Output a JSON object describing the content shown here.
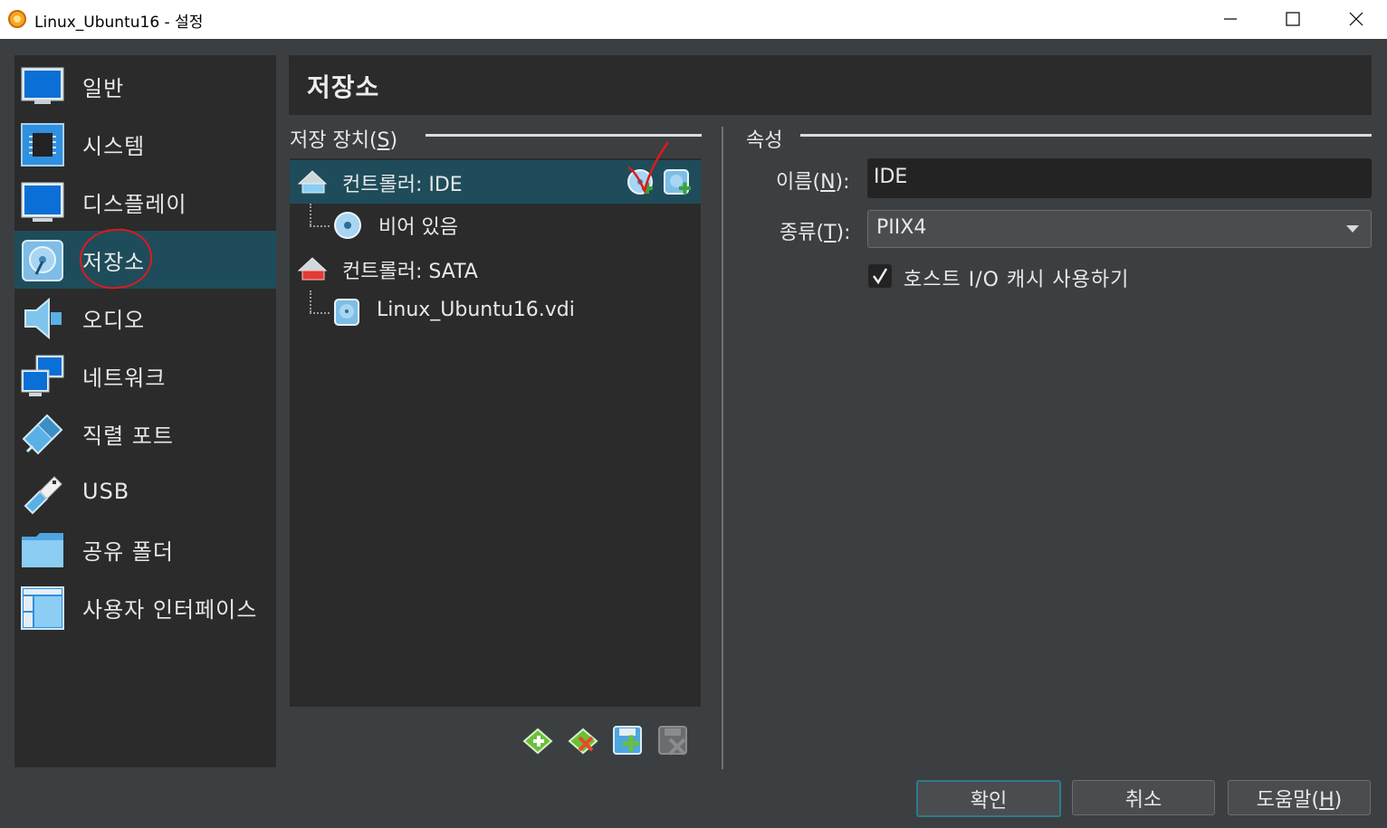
{
  "window": {
    "title": "Linux_Ubuntu16 - 설정"
  },
  "sidebar": {
    "items": [
      {
        "label": "일반",
        "icon": "monitor-general-icon"
      },
      {
        "label": "시스템",
        "icon": "chip-icon"
      },
      {
        "label": "디스플레이",
        "icon": "display-icon"
      },
      {
        "label": "저장소",
        "icon": "storage-disk-icon"
      },
      {
        "label": "오디오",
        "icon": "speaker-icon"
      },
      {
        "label": "네트워크",
        "icon": "network-icon"
      },
      {
        "label": "직렬 포트",
        "icon": "serial-port-icon"
      },
      {
        "label": "USB",
        "icon": "usb-icon"
      },
      {
        "label": "공유 폴더",
        "icon": "folder-icon"
      },
      {
        "label": "사용자 인터페이스",
        "icon": "ui-window-icon"
      }
    ],
    "selected": "저장소"
  },
  "page": {
    "title": "저장소"
  },
  "storage": {
    "label": "저장 장치(S)",
    "label_plain": "저장 장치(",
    "label_key": "S",
    "label_end": ")",
    "tree": [
      {
        "label": "컨트롤러: IDE",
        "type": "controller",
        "selected": true
      },
      {
        "label": "비어 있음",
        "type": "optical"
      },
      {
        "label": "컨트롤러: SATA",
        "type": "controller"
      },
      {
        "label": "Linux_Ubuntu16.vdi",
        "type": "harddisk"
      }
    ],
    "toolbar": [
      "add-controller-icon",
      "remove-controller-icon",
      "add-attachment-icon",
      "remove-attachment-icon"
    ]
  },
  "attributes": {
    "label": "속성",
    "name_label_pre": "이름(",
    "name_label_key": "N",
    "name_label_post": "):",
    "name_value": "IDE",
    "type_label_pre": "종류(",
    "type_label_key": "T",
    "type_label_post": "):",
    "type_value": "PIIX4",
    "cache_label": "호스트 I/O 캐시 사용하기",
    "cache_checked": true
  },
  "buttons": {
    "ok": "확인",
    "cancel": "취소",
    "help_pre": "도움말(",
    "help_key": "H",
    "help_post": ")"
  },
  "colors": {
    "selection": "#1f4c5a",
    "annotation": "#e0191c"
  }
}
